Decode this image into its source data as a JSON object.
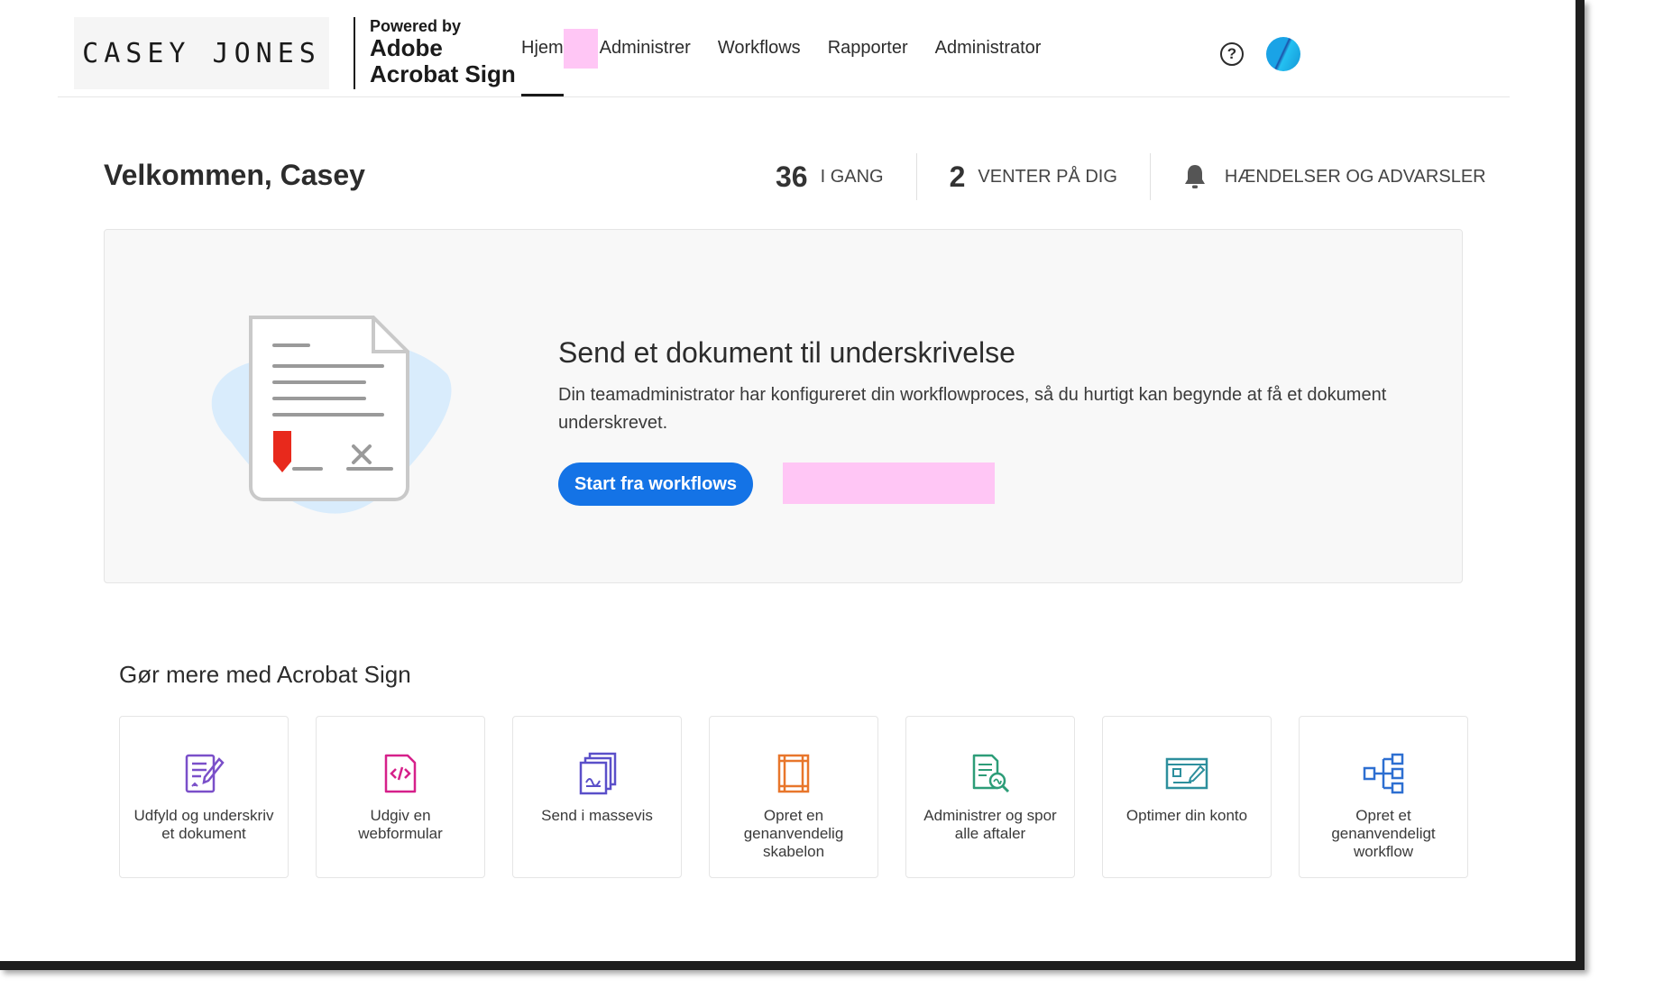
{
  "brand": {
    "company_logo_text": "CASEY JONES",
    "powered_by": "Powered by",
    "product_line1": "Adobe",
    "product_line2": "Acrobat Sign"
  },
  "nav": {
    "items": [
      {
        "label": "Hjem",
        "active": true
      },
      {
        "label": "Administrer"
      },
      {
        "label": "Workflows"
      },
      {
        "label": "Rapporter"
      },
      {
        "label": "Administrator"
      }
    ]
  },
  "header_icons": {
    "help": "help-icon",
    "help_glyph": "?",
    "avatar": "avatar"
  },
  "welcome": {
    "title": "Velkommen, Casey"
  },
  "stats": {
    "in_progress_count": "36",
    "in_progress_label": "I GANG",
    "waiting_count": "2",
    "waiting_label": "VENTER PÅ DIG",
    "events_label": "HÆNDELSER OG ADVARSLER"
  },
  "hero": {
    "title": "Send et dokument til underskrivelse",
    "description": "Din teamadministrator har konfigureret din workflowproces, så du hurtigt kan begynde at få et dokument underskrevet.",
    "primary_button": "Start fra workflows"
  },
  "more": {
    "title": "Gør mere med Acrobat Sign",
    "tiles": [
      {
        "label": "Udfyld og underskriv et dokument",
        "icon": "fill-sign-icon"
      },
      {
        "label": "Udgiv en webformular",
        "icon": "web-form-icon"
      },
      {
        "label": "Send i massevis",
        "icon": "bulk-send-icon"
      },
      {
        "label": "Opret en genanvendelig skabelon",
        "icon": "template-icon"
      },
      {
        "label": "Administrer og spor alle aftaler",
        "icon": "track-agreements-icon"
      },
      {
        "label": "Optimer din konto",
        "icon": "optimize-account-icon"
      },
      {
        "label": "Opret et genanvendeligt workflow",
        "icon": "workflow-icon"
      }
    ]
  },
  "colors": {
    "primary_button": "#1473e6",
    "signature_flag": "#e8291c",
    "illustration_blob": "#d9ecfc",
    "icon_purple": "#7a4fc9",
    "icon_magenta": "#d6208a",
    "icon_indigo": "#5a4fc9",
    "icon_orange": "#e8762b",
    "icon_green": "#2d9d78",
    "icon_teal": "#2d8f9d",
    "icon_blue": "#2d6fd1",
    "redaction": "#ffc6f5"
  }
}
